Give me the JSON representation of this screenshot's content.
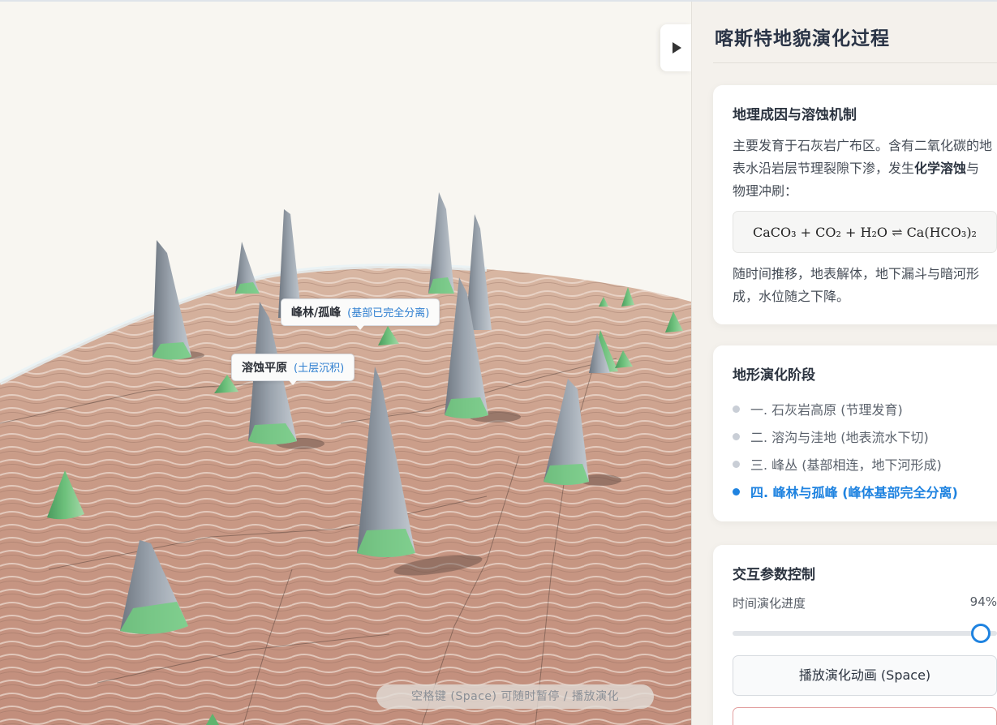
{
  "scene": {
    "label_peak_forest": {
      "title": "峰林/孤峰",
      "note": "(基部已完全分离)"
    },
    "label_plain": {
      "title": "溶蚀平原",
      "note": "(土层沉积)"
    },
    "hint": "空格键 (Space) 可随时暂停 / 播放演化"
  },
  "panel": {
    "title": "喀斯特地貌演化过程",
    "cause": {
      "heading": "地理成因与溶蚀机制",
      "text_before": "主要发育于石灰岩广布区。含有二氧化碳的地表水沿岩层节理裂隙下渗，发生",
      "text_bold": "化学溶蚀",
      "text_after": "与物理冲刷：",
      "formula": "CaCO₃ + CO₂ + H₂O ⇌ Ca(HCO₃)₂",
      "text_end": "随时间推移，地表解体，地下漏斗与暗河形成，水位随之下降。"
    },
    "stages": {
      "heading": "地形演化阶段",
      "items": [
        {
          "label": "一. 石灰岩高原 (节理发育)",
          "active": false
        },
        {
          "label": "二. 溶沟与洼地 (地表流水下切)",
          "active": false
        },
        {
          "label": "三. 峰丛 (基部相连，地下河形成)",
          "active": false
        },
        {
          "label": "四. 峰林与孤峰 (峰体基部完全分离)",
          "active": true
        }
      ]
    },
    "controls": {
      "heading": "交互参数控制",
      "progress_label": "时间演化进度",
      "progress_text": "94%",
      "progress_value": 0.94,
      "play_button": "播放演化动画 (Space)"
    }
  },
  "icons": {
    "toggle": "play-triangle-icon"
  }
}
